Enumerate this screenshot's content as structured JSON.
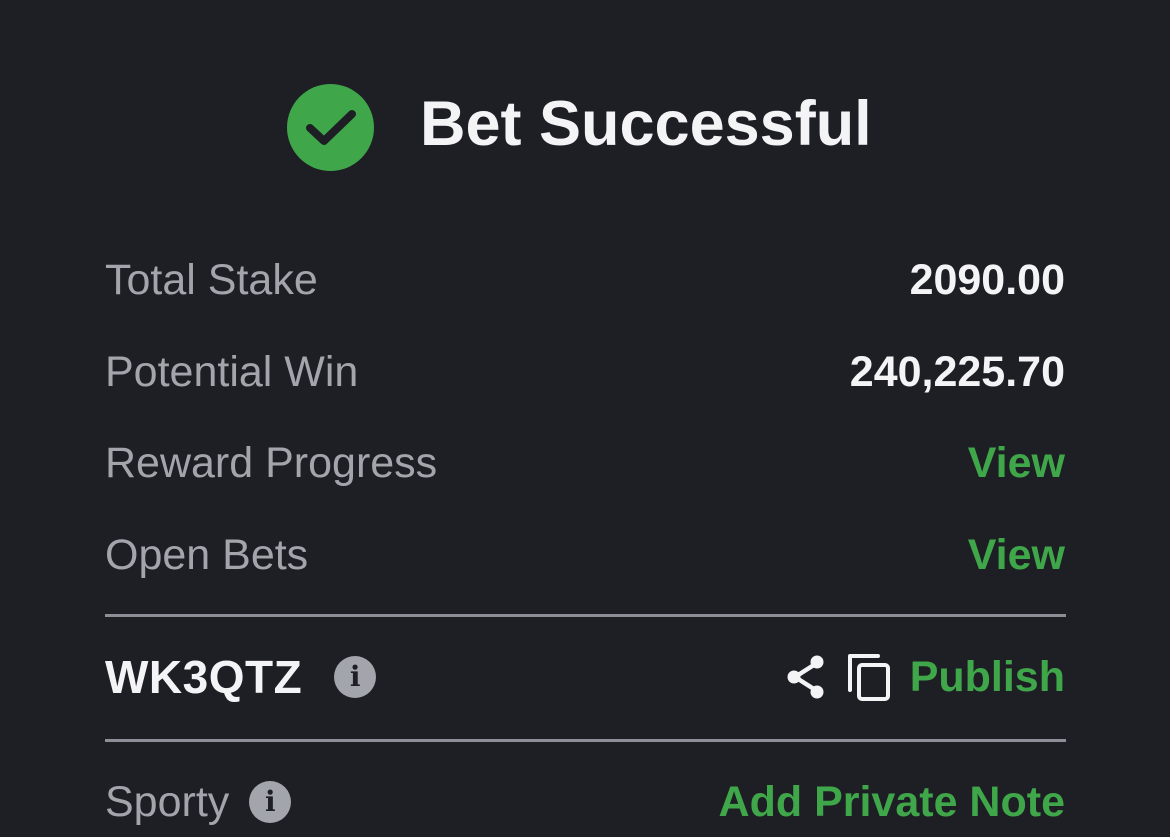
{
  "header": {
    "title": "Bet Successful",
    "status_icon": "checkmark-circle-icon",
    "accent_color": "#3fa74a"
  },
  "summary": {
    "total_stake_label": "Total Stake",
    "total_stake_value": "2090.00",
    "potential_win_label": "Potential Win",
    "potential_win_value": "240,225.70",
    "reward_progress_label": "Reward Progress",
    "reward_progress_link": "View",
    "open_bets_label": "Open Bets",
    "open_bets_link": "View"
  },
  "booking": {
    "code": "WK3QTZ",
    "info_icon": "info-icon",
    "share_icon": "share-icon",
    "copy_icon": "copy-icon",
    "publish_label": "Publish"
  },
  "note": {
    "label": "Sporty",
    "info_icon": "info-icon",
    "add_note_label": "Add Private Note"
  },
  "colors": {
    "background": "#1e1f24",
    "primary_text": "#f4f4f6",
    "secondary_text": "#a3a5ad",
    "link": "#3fa74a"
  }
}
